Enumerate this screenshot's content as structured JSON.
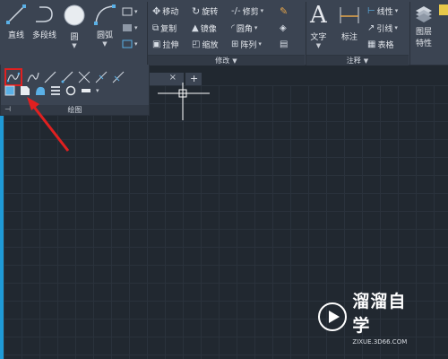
{
  "ribbon": {
    "draw_panel": {
      "line_label": "直线",
      "polyline_label": "多段线",
      "circle_label": "圆",
      "arc_label": "圆弧"
    },
    "modify_panel": {
      "move": "移动",
      "rotate": "旋转",
      "trim": "修剪",
      "copy": "复制",
      "mirror": "镜像",
      "fillet": "圆角",
      "stretch": "拉伸",
      "scale": "缩放",
      "array": "阵列",
      "title": "修改"
    },
    "annotation_panel": {
      "text": "文字",
      "dimension": "标注",
      "linear": "线性",
      "leader": "引线",
      "table": "表格",
      "title": "注释"
    },
    "layers_panel": {
      "layer_properties_line1": "图层",
      "layer_properties_line2": "特性"
    }
  },
  "draw_flyout": {
    "title": "绘图"
  },
  "tabs": {
    "new_tab_symbol": "+",
    "close_symbol": "×"
  },
  "watermark": {
    "title": "溜溜自学",
    "subtitle": "ZIXUE.3D66.COM"
  },
  "colors": {
    "ribbon_bg": "#3b4452",
    "canvas_bg": "#212830",
    "highlight": "#e02020",
    "accent_blue": "#1f9ad6"
  }
}
